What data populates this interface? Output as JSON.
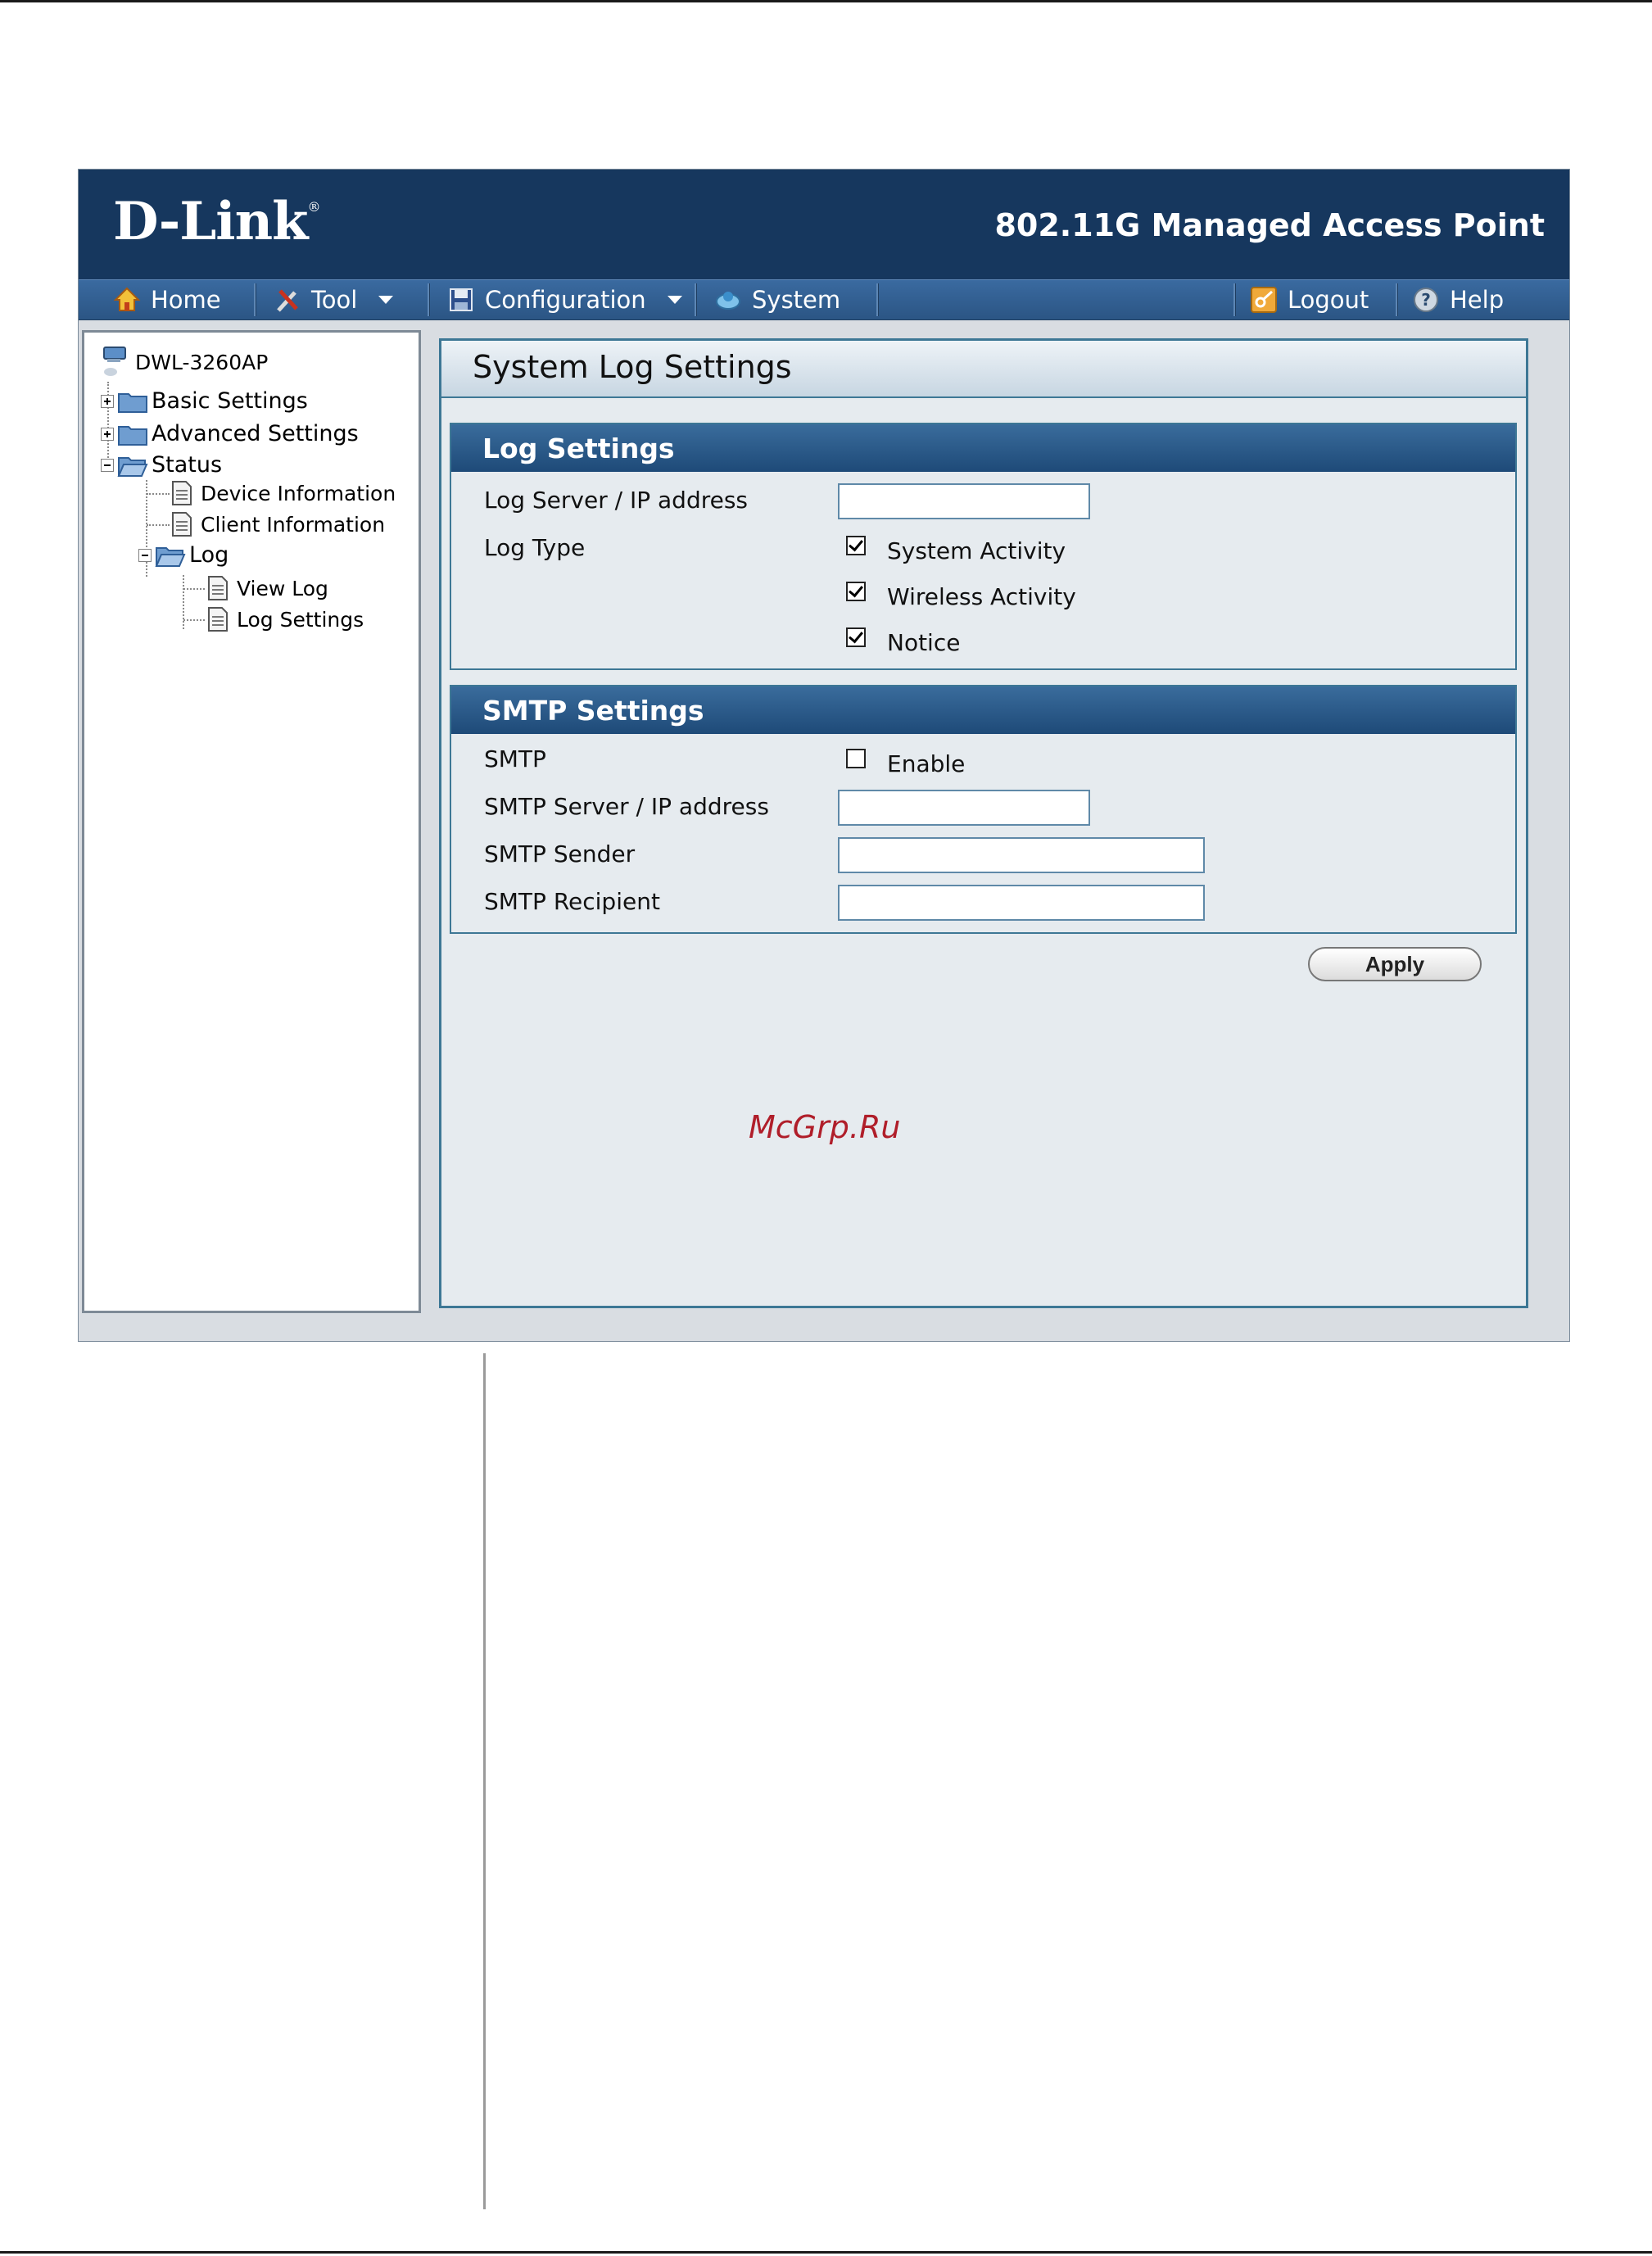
{
  "header": {
    "logo": "D-Link",
    "logo_mark": "®",
    "product": "802.11G Managed Access Point"
  },
  "nav": {
    "home": "Home",
    "tool": "Tool",
    "configuration": "Configuration",
    "system": "System",
    "logout": "Logout",
    "help": "Help"
  },
  "tree": {
    "root": "DWL-3260AP",
    "basic": "Basic Settings",
    "advanced": "Advanced Settings",
    "status": "Status",
    "device_info": "Device Information",
    "client_info": "Client Information",
    "log": "Log",
    "view_log": "View Log",
    "log_settings": "Log Settings"
  },
  "page": {
    "title": "System Log Settings"
  },
  "log_section": {
    "title": "Log Settings",
    "server_label": "Log Server / IP address",
    "server_value": "",
    "type_label": "Log Type",
    "types": [
      {
        "label": "System Activity",
        "checked": true
      },
      {
        "label": "Wireless Activity",
        "checked": true
      },
      {
        "label": "Notice",
        "checked": true
      }
    ]
  },
  "smtp_section": {
    "title": "SMTP Settings",
    "smtp_label": "SMTP",
    "enable_label": "Enable",
    "enable_checked": false,
    "server_label": "SMTP Server / IP address",
    "server_value": "",
    "sender_label": "SMTP Sender",
    "sender_value": "",
    "recipient_label": "SMTP Recipient",
    "recipient_value": ""
  },
  "apply_label": "Apply",
  "watermark": "McGrp.Ru"
}
